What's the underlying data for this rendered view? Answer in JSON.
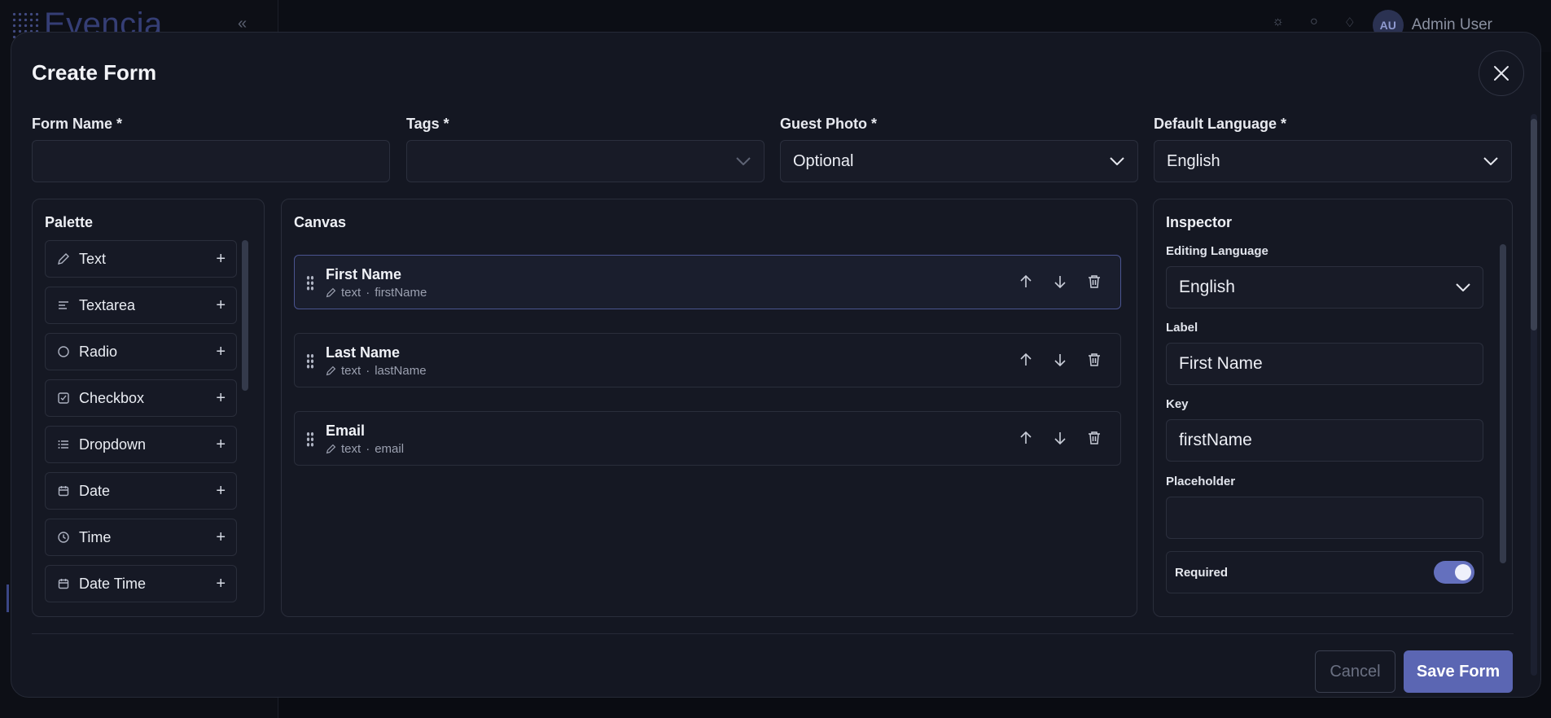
{
  "background": {
    "brand": "Evencia",
    "user_initials": "AU",
    "user_name": "Admin User"
  },
  "modal": {
    "title": "Create Form",
    "fields": {
      "form_name": {
        "label": "Form Name *",
        "value": ""
      },
      "tags": {
        "label": "Tags *",
        "value": ""
      },
      "guest_photo": {
        "label": "Guest Photo *",
        "value": "Optional"
      },
      "default_language": {
        "label": "Default Language *",
        "value": "English"
      }
    },
    "palette": {
      "title": "Palette",
      "items": [
        {
          "label": "Text",
          "icon": "pencil-icon"
        },
        {
          "label": "Textarea",
          "icon": "lines-icon"
        },
        {
          "label": "Radio",
          "icon": "radio-icon"
        },
        {
          "label": "Checkbox",
          "icon": "checkbox-icon"
        },
        {
          "label": "Dropdown",
          "icon": "list-icon"
        },
        {
          "label": "Date",
          "icon": "calendar-icon"
        },
        {
          "label": "Time",
          "icon": "clock-icon"
        },
        {
          "label": "Date Time",
          "icon": "calendar-icon"
        }
      ]
    },
    "canvas": {
      "title": "Canvas",
      "rows": [
        {
          "label": "First Name",
          "type": "text",
          "key": "firstName",
          "selected": true
        },
        {
          "label": "Last Name",
          "type": "text",
          "key": "lastName",
          "selected": false
        },
        {
          "label": "Email",
          "type": "text",
          "key": "email",
          "selected": false
        }
      ]
    },
    "inspector": {
      "title": "Inspector",
      "editing_language_label": "Editing Language",
      "editing_language_value": "English",
      "label_label": "Label",
      "label_value": "First Name",
      "key_label": "Key",
      "key_value": "firstName",
      "placeholder_label": "Placeholder",
      "placeholder_value": "",
      "required_label": "Required",
      "required_on": true
    },
    "footer": {
      "cancel_label": "Cancel",
      "save_label": "Save Form"
    }
  },
  "colors": {
    "accent": "#5b66b3",
    "toggle_on": "#6470be",
    "modal_bg": "#141722"
  }
}
